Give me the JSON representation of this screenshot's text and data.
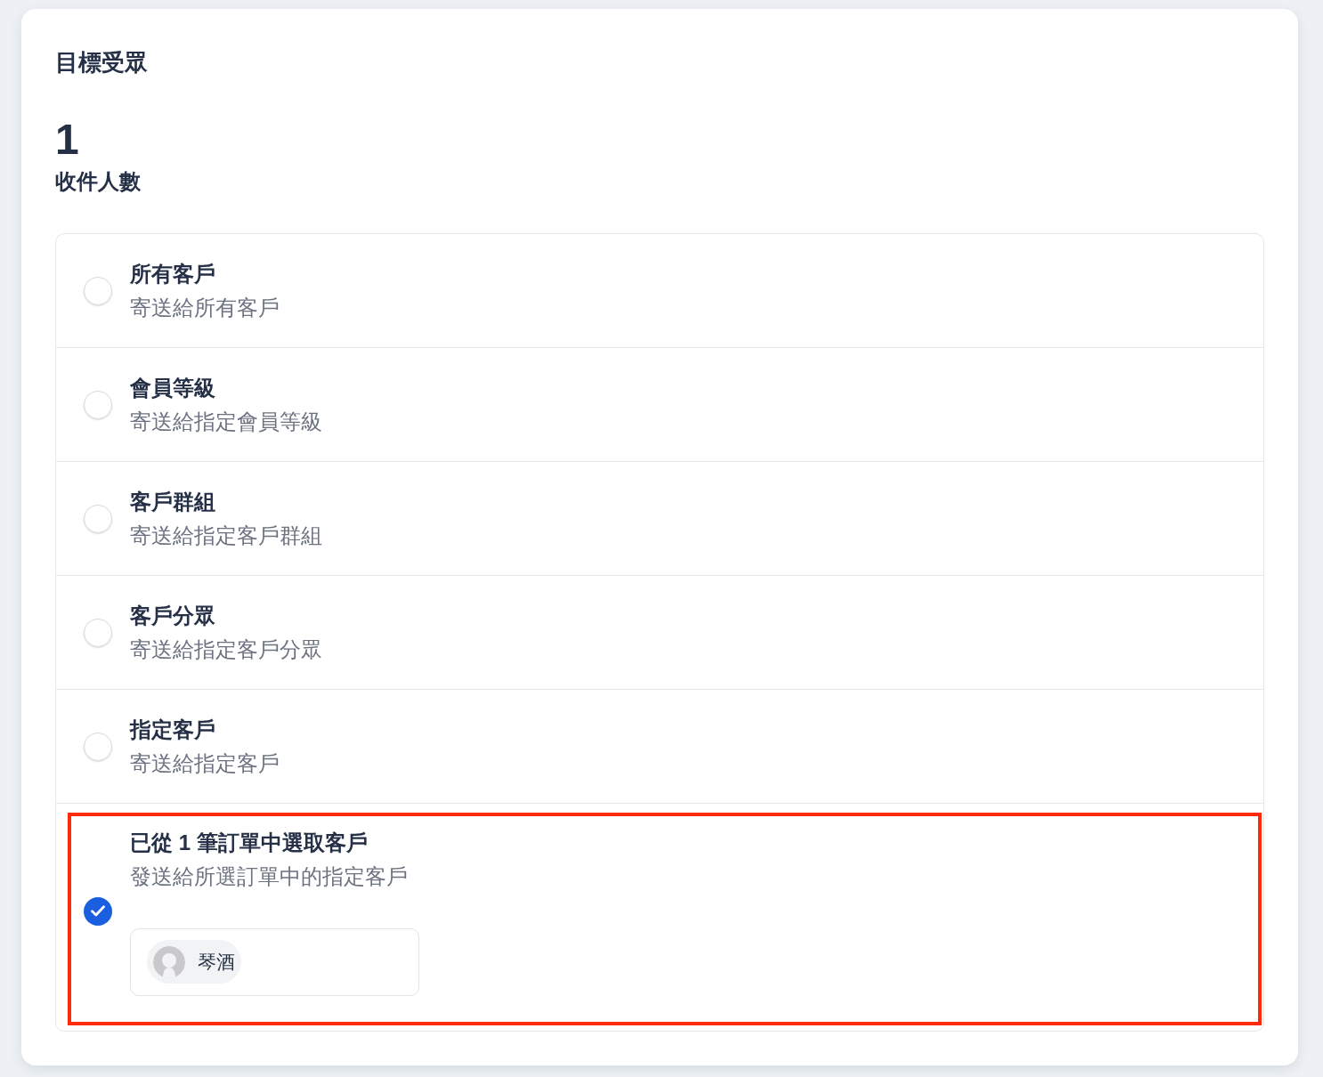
{
  "section": {
    "title": "目標受眾"
  },
  "recipients": {
    "count": "1",
    "label": "收件人數"
  },
  "options": [
    {
      "title": "所有客戶",
      "description": "寄送給所有客戶",
      "selected": false,
      "highlighted": false
    },
    {
      "title": "會員等級",
      "description": "寄送給指定會員等級",
      "selected": false,
      "highlighted": false
    },
    {
      "title": "客戶群組",
      "description": "寄送給指定客戶群組",
      "selected": false,
      "highlighted": false
    },
    {
      "title": "客戶分眾",
      "description": "寄送給指定客戶分眾",
      "selected": false,
      "highlighted": false
    },
    {
      "title": "指定客戶",
      "description": "寄送給指定客戶",
      "selected": false,
      "highlighted": false
    },
    {
      "title": "已從 1 筆訂單中選取客戶",
      "description": "發送給所選訂單中的指定客戶",
      "selected": true,
      "highlighted": true,
      "customers": [
        {
          "name": "琴酒"
        }
      ]
    }
  ]
}
